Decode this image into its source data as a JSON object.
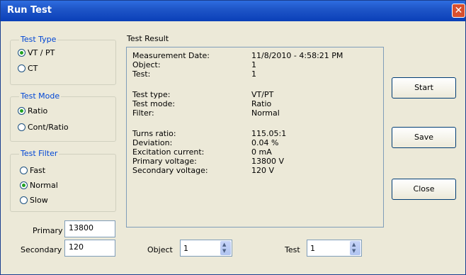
{
  "window": {
    "title": "Run Test"
  },
  "test_type": {
    "label": "Test Type",
    "options": [
      "VT / PT",
      "CT"
    ],
    "selected": "VT / PT"
  },
  "test_mode": {
    "label": "Test Mode",
    "options": [
      "Ratio",
      "Cont/Ratio"
    ],
    "selected": "Ratio"
  },
  "test_filter": {
    "label": "Test Filter",
    "options": [
      "Fast",
      "Normal",
      "Slow"
    ],
    "selected": "Normal"
  },
  "primary": {
    "label": "Primary",
    "value": "13800"
  },
  "secondary": {
    "label": "Secondary",
    "value": "120"
  },
  "result": {
    "label": "Test Result",
    "rows": [
      {
        "name": "Measurement Date:",
        "value": "11/8/2010 - 4:58:21 PM"
      },
      {
        "name": "Object:",
        "value": "1"
      },
      {
        "name": "Test:",
        "value": "1"
      },
      {
        "name": "Test type:",
        "value": "VT/PT"
      },
      {
        "name": "Test mode:",
        "value": "Ratio"
      },
      {
        "name": "Filter:",
        "value": "Normal"
      },
      {
        "name": "Turns ratio:",
        "value": "115.05:1"
      },
      {
        "name": "Deviation:",
        "value": "0.04 %"
      },
      {
        "name": "Excitation current:",
        "value": "0 mA"
      },
      {
        "name": "Primary voltage:",
        "value": "13800 V"
      },
      {
        "name": "Secondary voltage:",
        "value": "120 V"
      }
    ]
  },
  "buttons": {
    "start": "Start",
    "save": "Save",
    "close": "Close"
  },
  "object_spinner": {
    "label": "Object",
    "value": "1"
  },
  "test_spinner": {
    "label": "Test",
    "value": "1"
  }
}
